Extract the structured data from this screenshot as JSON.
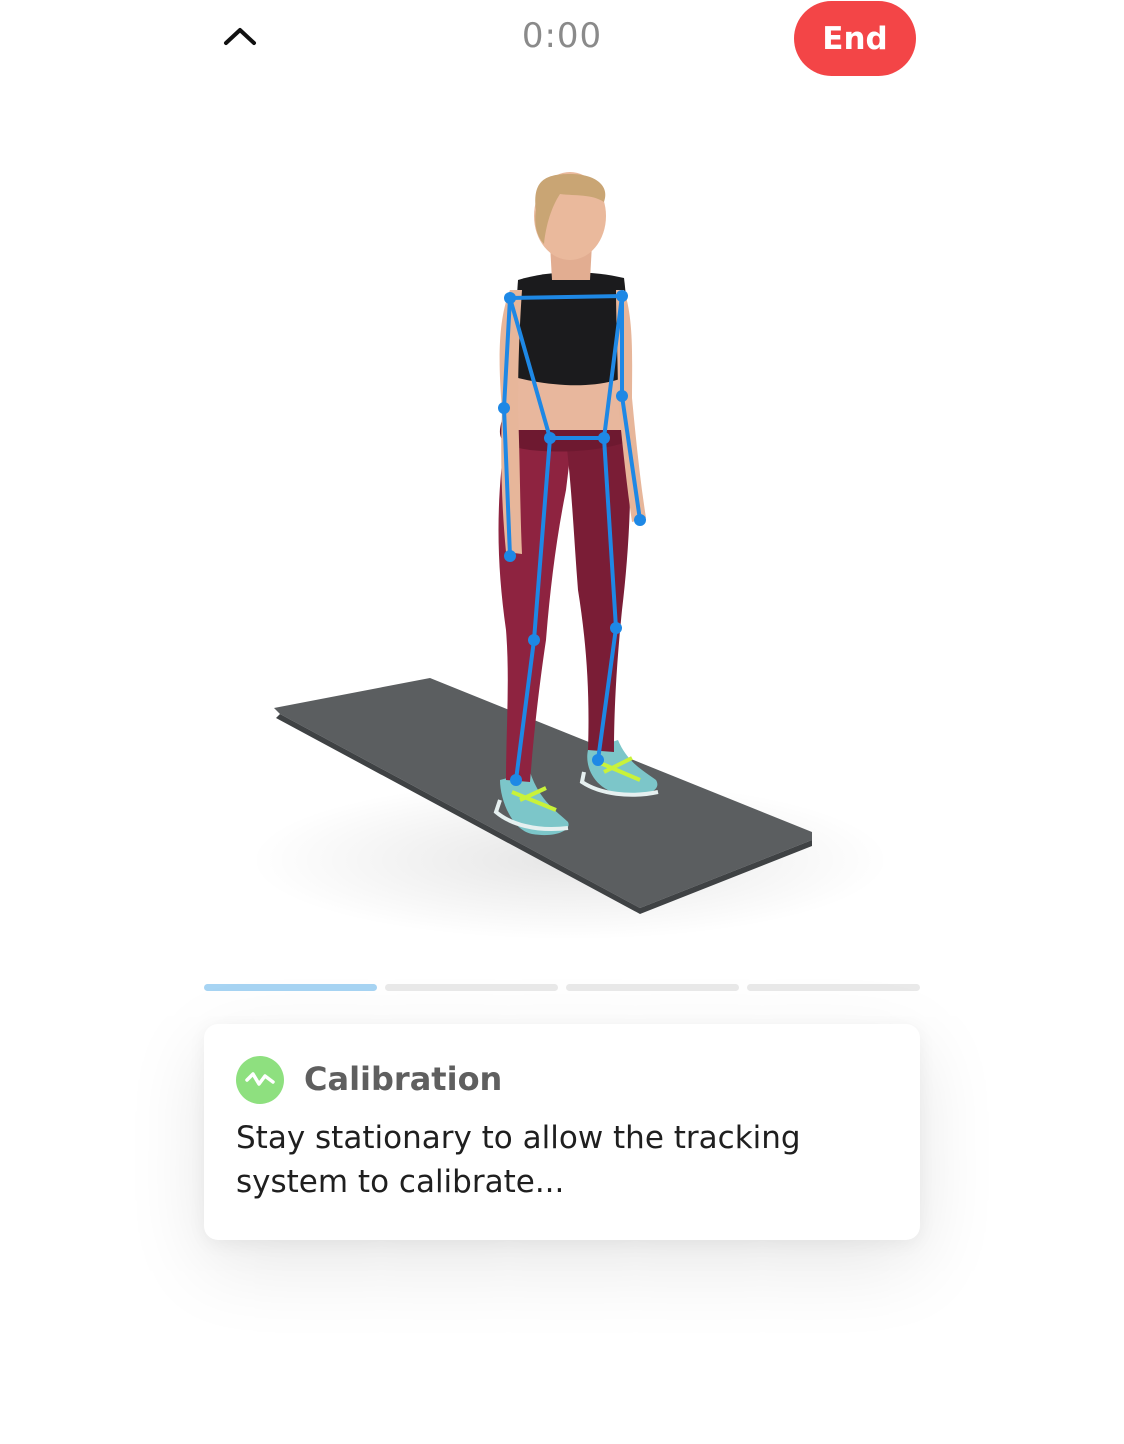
{
  "header": {
    "collapse_icon": "chevron-up-icon",
    "timer": "0:00",
    "end_label": "End",
    "end_color": "#f34547"
  },
  "illustration": {
    "subject_icon": "person-standing-on-mat",
    "pose_overlay_color": "#1e88e5"
  },
  "progress": {
    "steps": 4,
    "current_step": 1,
    "active_color": "#a7d4f3",
    "inactive_color": "#e9e9e9"
  },
  "card": {
    "icon": "activity-wave-icon",
    "icon_color": "#8ee07f",
    "title": "Calibration",
    "body": "Stay stationary to allow the tracking system to calibrate..."
  }
}
